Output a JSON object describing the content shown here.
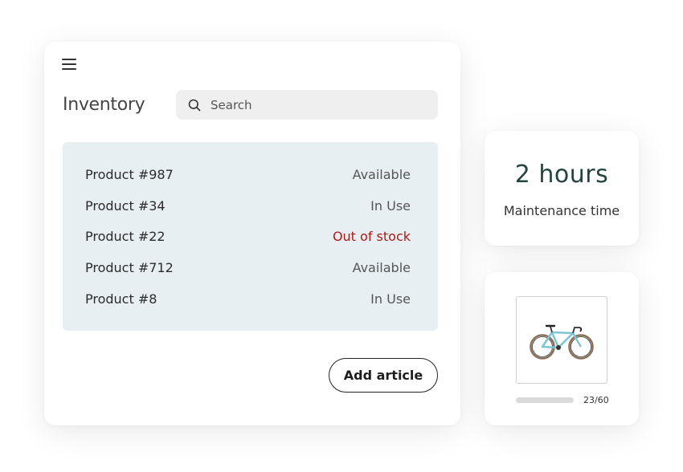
{
  "inventory": {
    "title": "Inventory",
    "search": {
      "placeholder": "Search",
      "value": ""
    },
    "items": [
      {
        "name": "Product #987",
        "status": "Available"
      },
      {
        "name": "Product #34",
        "status": "In Use"
      },
      {
        "name": "Product #22",
        "status": "Out of stock"
      },
      {
        "name": "Product #712",
        "status": "Available"
      },
      {
        "name": "Product #8",
        "status": "In Use"
      }
    ],
    "add_button_label": "Add article"
  },
  "maintenance": {
    "value": "2 hours",
    "label": "Maintenance time"
  },
  "product_preview": {
    "image_icon": "bicycle-icon",
    "progress_text": "23/60",
    "progress_current": 23,
    "progress_total": 60
  },
  "colors": {
    "list_background": "#e8eff2",
    "out_of_stock": "#a81b1b",
    "maintenance_value": "#24443f",
    "bike_frame": "#7ec6d3"
  },
  "icons": {
    "menu": "hamburger-menu-icon",
    "search": "search-icon"
  }
}
